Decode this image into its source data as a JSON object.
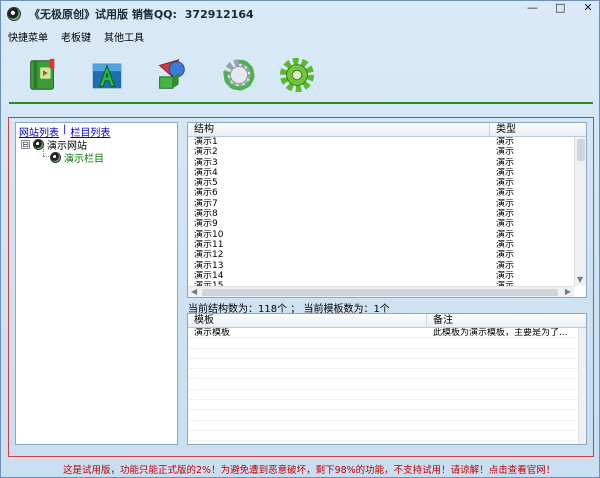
{
  "window": {
    "title": "《无极原创》试用版 销售QQ:",
    "qq": "372912164",
    "minimize": "—",
    "maximize": "□",
    "close": "✕"
  },
  "menu": [
    "快捷菜单",
    "老板键",
    "其他工具"
  ],
  "toolbar": {
    "buttons": [
      {
        "icon": "green-book-icon"
      },
      {
        "icon": "letter-a-icon"
      },
      {
        "icon": "shapes-icon"
      },
      {
        "icon": "refresh-gear-icon"
      },
      {
        "icon": "green-gear-icon"
      }
    ],
    "accent": "#2e8a1e"
  },
  "left_panel": {
    "tabs": [
      "网站列表",
      "栏目列表"
    ],
    "separator": "|",
    "tree": {
      "root": "演示网站",
      "expander": "⊟",
      "child": "演示栏目"
    }
  },
  "structure_table": {
    "columns": [
      "结构",
      "类型"
    ],
    "rows": [
      [
        "演示1",
        "演示"
      ],
      [
        "演示2",
        "演示"
      ],
      [
        "演示3",
        "演示"
      ],
      [
        "演示4",
        "演示"
      ],
      [
        "演示5",
        "演示"
      ],
      [
        "演示6",
        "演示"
      ],
      [
        "演示7",
        "演示"
      ],
      [
        "演示8",
        "演示"
      ],
      [
        "演示9",
        "演示"
      ],
      [
        "演示10",
        "演示"
      ],
      [
        "演示11",
        "演示"
      ],
      [
        "演示12",
        "演示"
      ],
      [
        "演示13",
        "演示"
      ],
      [
        "演示14",
        "演示"
      ],
      [
        "演示15",
        "演示"
      ]
    ]
  },
  "counts": "当前结构数为：118个 ； 当前模板数为：1个",
  "template_table": {
    "columns": [
      "模板",
      "备注"
    ],
    "rows": [
      [
        "演示模板",
        "此模板为演示模板，主要是为了..."
      ]
    ]
  },
  "trial_note": "这是试用版，功能只能正式版的2%！为避免遭到恶意破坏，剩下98%的功能，不支持试用！请谅解！点击查看官网！",
  "colors": {
    "frame_red": "#d04040",
    "note_red": "#c00000",
    "link_blue": "#0000cc",
    "tree_child_green": "#0a7a0a"
  }
}
